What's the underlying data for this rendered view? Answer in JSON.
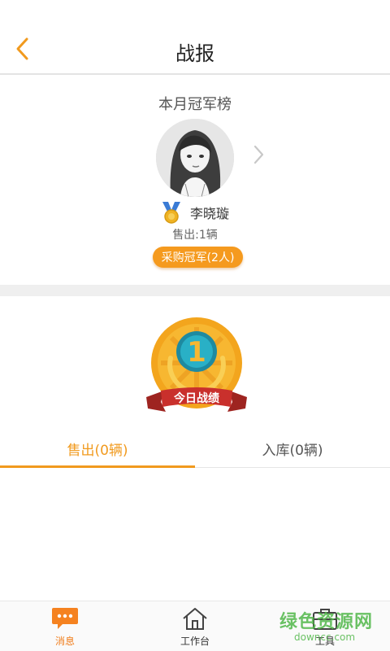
{
  "header": {
    "title": "战报",
    "back_icon": "chevron-left-icon"
  },
  "champion": {
    "section_title": "本月冠军榜",
    "name": "李晓璇",
    "sold": "售出:1辆",
    "badge": "采购冠军(2人)",
    "next_icon": "chevron-right-icon"
  },
  "trophy": {
    "rank": "1",
    "label": "今日战绩"
  },
  "tabs": [
    {
      "label": "售出(0辆)",
      "active": true
    },
    {
      "label": "入库(0辆)",
      "active": false
    }
  ],
  "bottom_nav": [
    {
      "label": "消息",
      "icon": "message-icon",
      "active": true
    },
    {
      "label": "工作台",
      "icon": "home-icon",
      "active": false
    },
    {
      "label": "工具",
      "icon": "toolbox-icon",
      "active": false
    }
  ],
  "watermark": {
    "main": "绿色资源网",
    "sub": "downcc.com"
  },
  "colors": {
    "accent": "#f19a1e",
    "divider": "#efefef",
    "ribbon": "#c9302c"
  }
}
